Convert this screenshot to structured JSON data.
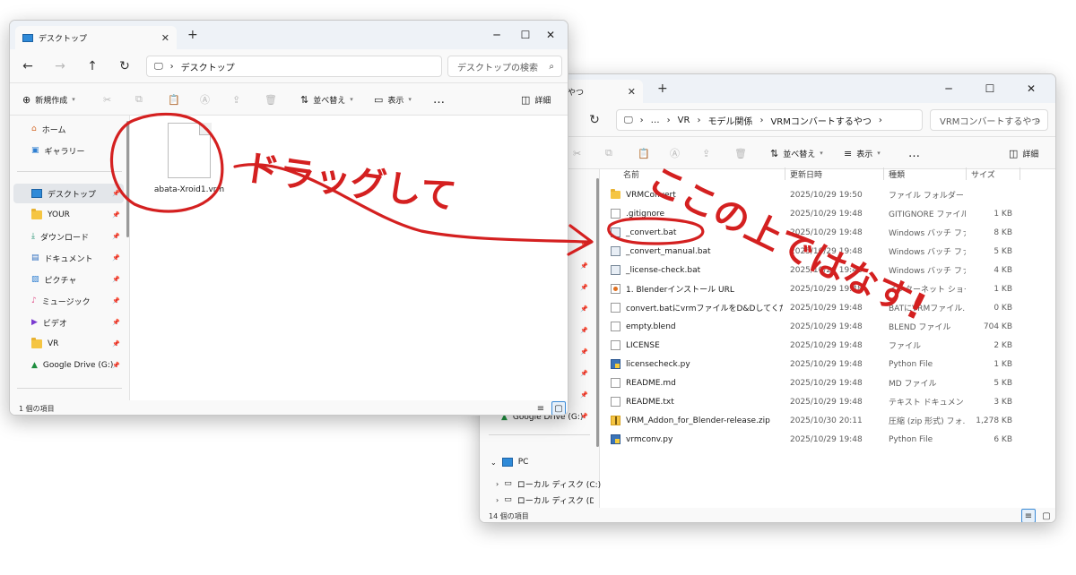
{
  "left_window": {
    "tab_label": "デスクトップ",
    "address": "デスクトップ",
    "search_placeholder": "デスクトップの検索",
    "commands": {
      "new": "新規作成",
      "sort": "並べ替え",
      "view": "表示",
      "more": "…",
      "details": "詳細"
    },
    "sidebar": {
      "home": "ホーム",
      "gallery": "ギャラリー",
      "desktop": "デスクトップ",
      "your": "YOUR",
      "downloads": "ダウンロード",
      "documents": "ドキュメント",
      "pictures": "ピクチャ",
      "music": "ミュージック",
      "videos": "ビデオ",
      "vr": "VR",
      "gdrive": "Google Drive (G:)"
    },
    "file_name": "abata-Xroid1.vrm",
    "status": "1 個の項目"
  },
  "right_window": {
    "tab_label": "やつ",
    "breadcrumb": {
      "more": "…",
      "part1": "VR",
      "part2": "モデル関係",
      "part3": "VRMコンバートするやつ"
    },
    "search_placeholder": "VRMコンバートするやつ",
    "commands": {
      "sort": "並べ替え",
      "view": "表示",
      "more": "…",
      "details": "詳細"
    },
    "columns": {
      "name": "名前",
      "date": "更新日時",
      "type": "種類",
      "size": "サイズ"
    },
    "files": [
      {
        "name": "VRMConvert",
        "date": "2025/10/29 19:50",
        "type": "ファイル フォルダー",
        "size": "",
        "icon": "folder-icon"
      },
      {
        "name": ".gitignore",
        "date": "2025/10/29 19:48",
        "type": "GITIGNORE ファイル",
        "size": "1 KB",
        "icon": "file-icon"
      },
      {
        "name": "_convert.bat",
        "date": "2025/10/29 19:48",
        "type": "Windows バッチ ファ...",
        "size": "8 KB",
        "icon": "batch-file-icon"
      },
      {
        "name": "_convert_manual.bat",
        "date": "2025/10/29 19:48",
        "type": "Windows バッチ ファ...",
        "size": "5 KB",
        "icon": "batch-file-icon"
      },
      {
        "name": "_license-check.bat",
        "date": "2025/10/29 19:48",
        "type": "Windows バッチ ファ...",
        "size": "4 KB",
        "icon": "batch-file-icon"
      },
      {
        "name": "1. Blenderインストール URL",
        "date": "2025/10/29 19:48",
        "type": "インターネット ショート...",
        "size": "1 KB",
        "icon": "url-shortcut-icon"
      },
      {
        "name": "convert.batにvrmファイルをD&Dしてください。...",
        "date": "2025/10/29 19:48",
        "type": "BATにVRMファイル...",
        "size": "0 KB",
        "icon": "file-icon"
      },
      {
        "name": "empty.blend",
        "date": "2025/10/29 19:48",
        "type": "BLEND ファイル",
        "size": "704 KB",
        "icon": "file-icon"
      },
      {
        "name": "LICENSE",
        "date": "2025/10/29 19:48",
        "type": "ファイル",
        "size": "2 KB",
        "icon": "file-icon"
      },
      {
        "name": "licensecheck.py",
        "date": "2025/10/29 19:48",
        "type": "Python File",
        "size": "1 KB",
        "icon": "python-file-icon"
      },
      {
        "name": "README.md",
        "date": "2025/10/29 19:48",
        "type": "MD ファイル",
        "size": "5 KB",
        "icon": "file-icon"
      },
      {
        "name": "README.txt",
        "date": "2025/10/29 19:48",
        "type": "テキスト ドキュメント",
        "size": "3 KB",
        "icon": "file-icon"
      },
      {
        "name": "VRM_Addon_for_Blender-release.zip",
        "date": "2025/10/30 20:11",
        "type": "圧縮 (zip 形式) フォ...",
        "size": "1,278 KB",
        "icon": "zip-folder-icon"
      },
      {
        "name": "vrmconv.py",
        "date": "2025/10/29 19:48",
        "type": "Python File",
        "size": "6 KB",
        "icon": "python-file-icon"
      }
    ],
    "sidebar": {
      "gdrive": "Google Drive (G:)",
      "pc": "PC",
      "local_c": "ローカル ディスク (C:)",
      "local_d": "ローカル ディスク (D:)"
    },
    "status": "14 個の項目"
  },
  "annotations": {
    "drag_text": "ドラッグして",
    "not_here_text": "ここの上ではなす!"
  },
  "colors": {
    "annotation_red": "#d42020",
    "accent_blue": "#3a8ad6"
  }
}
